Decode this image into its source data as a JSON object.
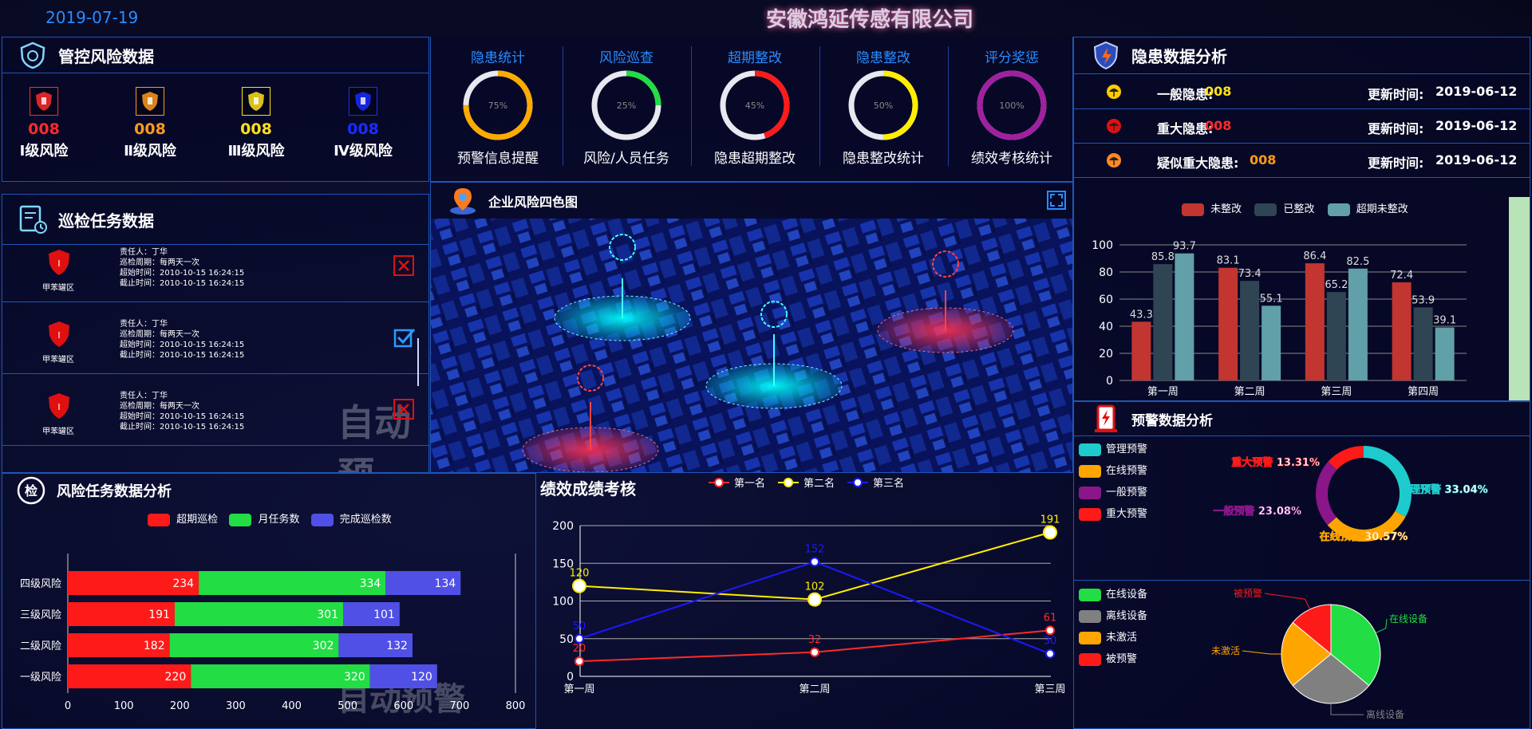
{
  "header": {
    "date": "2019-07-19",
    "company": "安徽鸿延传感有限公司"
  },
  "risk_control": {
    "title": "管控风险数据",
    "levels": [
      {
        "count": "008",
        "label": "Ⅰ级风险",
        "color": "#ff2a2a"
      },
      {
        "count": "008",
        "label": "Ⅱ级风险",
        "color": "#ff9a1a"
      },
      {
        "count": "008",
        "label": "Ⅲ级风险",
        "color": "#ffe21a"
      },
      {
        "count": "008",
        "label": "Ⅳ级风险",
        "color": "#1a2cff"
      }
    ]
  },
  "inspection": {
    "title": "巡检任务数据",
    "tasks": [
      {
        "area": "甲苯罐区",
        "l1": "责任人：丁华",
        "l2": "巡检周期：每两天一次",
        "l3": "超始时间：2010-10-15 16:24:15",
        "l4": "截止时间：2010-10-15 16:24:15",
        "status": "close"
      },
      {
        "area": "甲苯罐区",
        "l1": "责任人：丁华",
        "l2": "巡检周期：每两天一次",
        "l3": "超始时间：2010-10-15 16:24:15",
        "l4": "截止时间：2010-10-15 16:24:15",
        "status": "check"
      },
      {
        "area": "甲苯罐区",
        "l1": "责任人：丁华",
        "l2": "巡检周期：每两天一次",
        "l3": "超始时间：2010-10-15 16:24:15",
        "l4": "截止时间：2010-10-15 16:24:15",
        "status": "close"
      }
    ],
    "watermark": "自动预"
  },
  "gauges": [
    {
      "title": "隐患统计",
      "pct": "75%",
      "value": 0.75,
      "color": "#ffaa00",
      "label": "预警信息提醒"
    },
    {
      "title": "风险巡查",
      "pct": "25%",
      "value": 0.25,
      "color": "#22dd44",
      "label": "风险/人员任务"
    },
    {
      "title": "超期整改",
      "pct": "45%",
      "value": 0.45,
      "color": "#ff1a1a",
      "label": "隐患超期整改"
    },
    {
      "title": "隐患整改",
      "pct": "50%",
      "value": 0.5,
      "color": "#ffee00",
      "label": "隐患整改统计"
    },
    {
      "title": "评分奖惩",
      "pct": "100%",
      "value": 1.0,
      "color": "#a020a0",
      "label": "绩效考核统计"
    }
  ],
  "map": {
    "title": "企业风险四色图"
  },
  "hazard": {
    "title": "隐患数据分析",
    "rows": [
      {
        "label": "一般隐患:",
        "count": "008",
        "count_color": "#ffe21a",
        "time_label": "更新时间:",
        "time": "2019-06-12",
        "icon_color": "#ffcc00"
      },
      {
        "label": "重大隐患:",
        "count": "008",
        "count_color": "#ff2a2a",
        "time_label": "更新时间:",
        "time": "2019-06-12",
        "icon_color": "#dd1111"
      },
      {
        "label": "疑似重大隐患:",
        "count": "008",
        "count_color": "#ff9a1a",
        "time_label": "更新时间:",
        "time": "2019-06-12",
        "icon_color": "#ff8822"
      }
    ]
  },
  "hazard_chart": {
    "legend": [
      "未整改",
      "已整改",
      "超期未整改"
    ]
  },
  "warning": {
    "title": "预警数据分析",
    "legend": [
      "管理预警",
      "在线预警",
      "一般预警",
      "重大预警"
    ]
  },
  "device": {
    "legend": [
      "在线设备",
      "离线设备",
      "未激活",
      "被预警"
    ]
  },
  "risk_task": {
    "title": "风险任务数据分析",
    "legend": [
      "超期巡检",
      "月任务数",
      "完成巡检数"
    ],
    "watermark": "自动预警"
  },
  "perf": {
    "title": "绩效成绩考核",
    "legend": [
      "第一名",
      "第二名",
      "第三名"
    ]
  },
  "chart_data": [
    {
      "type": "bar",
      "categories": [
        "第一周",
        "第二周",
        "第三周",
        "第四周"
      ],
      "series": [
        {
          "name": "未整改",
          "values": [
            43.3,
            83.1,
            86.4,
            72.4
          ],
          "color": "#c23531"
        },
        {
          "name": "已整改",
          "values": [
            85.8,
            73.4,
            65.2,
            53.9
          ],
          "color": "#2f4554"
        },
        {
          "name": "超期未整改",
          "values": [
            93.7,
            55.1,
            82.5,
            39.1
          ],
          "color": "#61a0a8"
        }
      ],
      "ylim": [
        0,
        100
      ],
      "yticks": [
        0,
        20,
        40,
        60,
        80,
        100
      ]
    },
    {
      "type": "pie",
      "slices": [
        {
          "name": "管理预警",
          "value": 33.04,
          "label": "管理预警 33.04%",
          "color": "#1ecbcc"
        },
        {
          "name": "在线预警",
          "value": 30.57,
          "label": "在线预警 30.57%",
          "color": "#ffa500"
        },
        {
          "name": "一般预警",
          "value": 23.08,
          "label": "一般预警 23.08%",
          "color": "#8a168a"
        },
        {
          "name": "重大预警",
          "value": 13.31,
          "label": "重大预警 13.31%",
          "color": "#ff1a1a"
        }
      ]
    },
    {
      "type": "pie",
      "slices": [
        {
          "name": "在线设备",
          "value": 36,
          "color": "#22dd44"
        },
        {
          "name": "离线设备",
          "value": 28,
          "color": "#808080"
        },
        {
          "name": "未激活",
          "value": 22,
          "color": "#ffa500"
        },
        {
          "name": "被预警",
          "value": 14,
          "color": "#ff1a1a"
        }
      ]
    },
    {
      "type": "bar",
      "orientation": "horizontal-stacked",
      "categories": [
        "四级风险",
        "三级风险",
        "二级风险",
        "一级风险"
      ],
      "series": [
        {
          "name": "超期巡检",
          "values": [
            234,
            191,
            182,
            220
          ],
          "color": "#ff1a1a"
        },
        {
          "name": "月任务数",
          "values": [
            334,
            301,
            302,
            320
          ],
          "color": "#22dd44"
        },
        {
          "name": "完成巡检数",
          "values": [
            134,
            101,
            132,
            120
          ],
          "color": "#5050e6"
        }
      ],
      "xlim": [
        0,
        800
      ],
      "xticks": [
        0,
        100,
        200,
        300,
        400,
        500,
        600,
        700,
        800
      ]
    },
    {
      "type": "line",
      "categories": [
        "第一周",
        "第二周",
        "第三周"
      ],
      "series": [
        {
          "name": "第一名",
          "values": [
            20,
            32,
            61
          ],
          "color": "#ff2a2a"
        },
        {
          "name": "第二名",
          "values": [
            120,
            102,
            191
          ],
          "color": "#ffee00"
        },
        {
          "name": "第三名",
          "values": [
            50,
            152,
            30
          ],
          "color": "#1a1aff"
        }
      ],
      "ylim": [
        0,
        200
      ],
      "yticks": [
        0,
        50,
        100,
        150,
        200
      ]
    }
  ]
}
